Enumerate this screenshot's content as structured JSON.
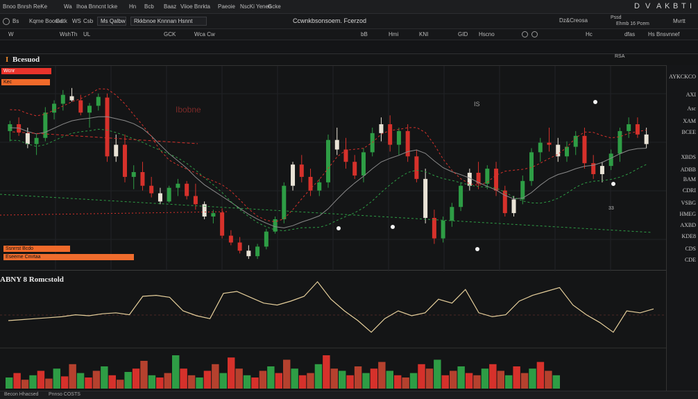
{
  "menubar": {
    "items": [
      "Bnoo Bnrsh ReKe",
      "Wa",
      "Ihoa Bnncnt lcke",
      "Hn",
      "Bcb",
      "Baaz",
      "Viioe Bnrkta",
      "Paeoie",
      "NscKi Yenen",
      "Gcke"
    ],
    "window_controls": [
      "D",
      "V",
      "A",
      "K",
      "B",
      "T",
      "I"
    ]
  },
  "toolbar1": {
    "left_items": [
      "Bs",
      "Kqme Boomd",
      "Gatk",
      "WS",
      "Csb"
    ],
    "search_placeholder": "Ms Qalbw",
    "preset_box": "Rkkbnoe Knnnan Hsnnt",
    "center_title": "Ccwnkbsonsoem. Fcerzod",
    "right_items": [
      "Dz&Creosa"
    ],
    "far_right": [
      "Pssd",
      "Ehmb 16 Pcem",
      "Mvrtt"
    ]
  },
  "toolbar2": {
    "items": [
      "W",
      "WshTh",
      "UL",
      "GCK",
      "Wca Cw",
      "bB",
      "Hmi",
      "KNI",
      "GID",
      "Hscno",
      "Hc",
      "dfas",
      "Hs Bnsvnnef"
    ],
    "badge": "RSA"
  },
  "main": {
    "title": "Bcesuod",
    "prefix": "I",
    "tag_top": "Wcnr",
    "tag_mid": "Kec",
    "watermark": "Ibobne",
    "marker_label": "IS",
    "point_label": "33",
    "left_bars": [
      "Ssnrrst Bcdo",
      "Eseeme Cmrtaa"
    ]
  },
  "oscillator": {
    "title": "ABNY 8 Romcstold"
  },
  "right_axis": {
    "header": "AYKCKCO",
    "labels": [
      "AXI",
      "Asc",
      "XAM",
      "BCEE",
      "XBDS",
      "ADBB",
      "BAM",
      "CDRI",
      "VSBG",
      "HMEG",
      "AXBD",
      "KDE8",
      "CDS",
      "CDE"
    ]
  },
  "status": {
    "left": "Becon Hhacsed",
    "mid": "Pnnso COSTS"
  },
  "colors": {
    "up": "#2e9d45",
    "down": "#d6312b",
    "neutral": "#e9e3d6",
    "orange": "#f06a2a",
    "line_beige": "#e6cf9b"
  },
  "chart_data": {
    "type": "candlestick",
    "series": [
      {
        "name": "price",
        "values": [
          [
            195,
            210,
            180,
            205
          ],
          [
            205,
            215,
            188,
            193
          ],
          [
            192,
            200,
            170,
            176
          ],
          [
            176,
            190,
            160,
            185
          ],
          [
            185,
            230,
            180,
            222
          ],
          [
            222,
            240,
            212,
            235
          ],
          [
            235,
            255,
            225,
            248
          ],
          [
            246,
            258,
            238,
            240
          ],
          [
            240,
            248,
            218,
            222
          ],
          [
            222,
            236,
            200,
            232
          ],
          [
            232,
            250,
            225,
            245
          ],
          [
            244,
            250,
            150,
            158
          ],
          [
            158,
            190,
            150,
            175
          ],
          [
            175,
            190,
            120,
            128
          ],
          [
            128,
            145,
            110,
            135
          ],
          [
            135,
            150,
            108,
            115
          ],
          [
            115,
            128,
            98,
            104
          ],
          [
            104,
            112,
            88,
            92
          ],
          [
            92,
            115,
            90,
            112
          ],
          [
            112,
            125,
            100,
            118
          ],
          [
            118,
            122,
            95,
            100
          ],
          [
            100,
            118,
            80,
            88
          ],
          [
            88,
            92,
            66,
            70
          ],
          [
            70,
            80,
            60,
            75
          ],
          [
            76,
            82,
            38,
            42
          ],
          [
            42,
            50,
            28,
            32
          ],
          [
            32,
            40,
            16,
            20
          ],
          [
            20,
            28,
            8,
            12
          ],
          [
            12,
            30,
            8,
            26
          ],
          [
            26,
            52,
            22,
            48
          ],
          [
            48,
            70,
            45,
            66
          ],
          [
            66,
            120,
            60,
            115
          ],
          [
            115,
            150,
            108,
            146
          ],
          [
            146,
            160,
            120,
            128
          ],
          [
            128,
            140,
            100,
            108
          ],
          [
            108,
            125,
            100,
            120
          ],
          [
            120,
            190,
            112,
            182
          ],
          [
            182,
            200,
            160,
            168
          ],
          [
            168,
            185,
            140,
            150
          ],
          [
            150,
            160,
            125,
            130
          ],
          [
            130,
            170,
            120,
            164
          ],
          [
            164,
            200,
            158,
            192
          ],
          [
            192,
            215,
            180,
            205
          ],
          [
            205,
            218,
            165,
            175
          ],
          [
            175,
            200,
            160,
            195
          ],
          [
            195,
            205,
            150,
            158
          ],
          [
            158,
            168,
            120,
            125
          ],
          [
            125,
            140,
            60,
            68
          ],
          [
            68,
            80,
            30,
            38
          ],
          [
            38,
            70,
            32,
            64
          ],
          [
            64,
            90,
            55,
            84
          ],
          [
            84,
            120,
            78,
            115
          ],
          [
            115,
            140,
            108,
            134
          ],
          [
            134,
            150,
            110,
            118
          ],
          [
            118,
            145,
            110,
            140
          ],
          [
            140,
            150,
            100,
            108
          ],
          [
            108,
            115,
            70,
            75
          ],
          [
            75,
            100,
            70,
            95
          ],
          [
            95,
            130,
            88,
            122
          ],
          [
            122,
            170,
            115,
            164
          ],
          [
            164,
            185,
            150,
            178
          ],
          [
            178,
            200,
            165,
            175
          ],
          [
            175,
            185,
            150,
            158
          ],
          [
            158,
            180,
            150,
            172
          ],
          [
            172,
            195,
            160,
            188
          ],
          [
            188,
            200,
            140,
            148
          ],
          [
            148,
            160,
            125,
            132
          ],
          [
            132,
            150,
            120,
            144
          ],
          [
            144,
            168,
            138,
            162
          ],
          [
            162,
            200,
            150,
            195
          ],
          [
            195,
            215,
            185,
            205
          ],
          [
            205,
            215,
            185,
            190
          ],
          [
            190,
            200,
            170,
            176
          ]
        ]
      }
    ],
    "oscillator_values": [
      20,
      21,
      22,
      23,
      24,
      26,
      25,
      27,
      28,
      26,
      45,
      46,
      44,
      30,
      25,
      22,
      48,
      50,
      44,
      38,
      36,
      40,
      45,
      60,
      42,
      30,
      20,
      8,
      22,
      30,
      25,
      28,
      42,
      38,
      52,
      28,
      24,
      26,
      40,
      46,
      50,
      54,
      36,
      26,
      18,
      8,
      30,
      28,
      32
    ],
    "volume_values": [
      10,
      14,
      8,
      12,
      16,
      9,
      18,
      11,
      22,
      14,
      10,
      16,
      20,
      12,
      8,
      15,
      18,
      25,
      12,
      10,
      14,
      30,
      18,
      12,
      10,
      16,
      22,
      14,
      28,
      18,
      12,
      10,
      16,
      20,
      14,
      26,
      18,
      12,
      14,
      22,
      30,
      18,
      16,
      12,
      20,
      14,
      18,
      24,
      16,
      12,
      10,
      14,
      22,
      18,
      26,
      12,
      16,
      20,
      14,
      12,
      18,
      22,
      16,
      12,
      20,
      14,
      18,
      24,
      16,
      12
    ]
  }
}
